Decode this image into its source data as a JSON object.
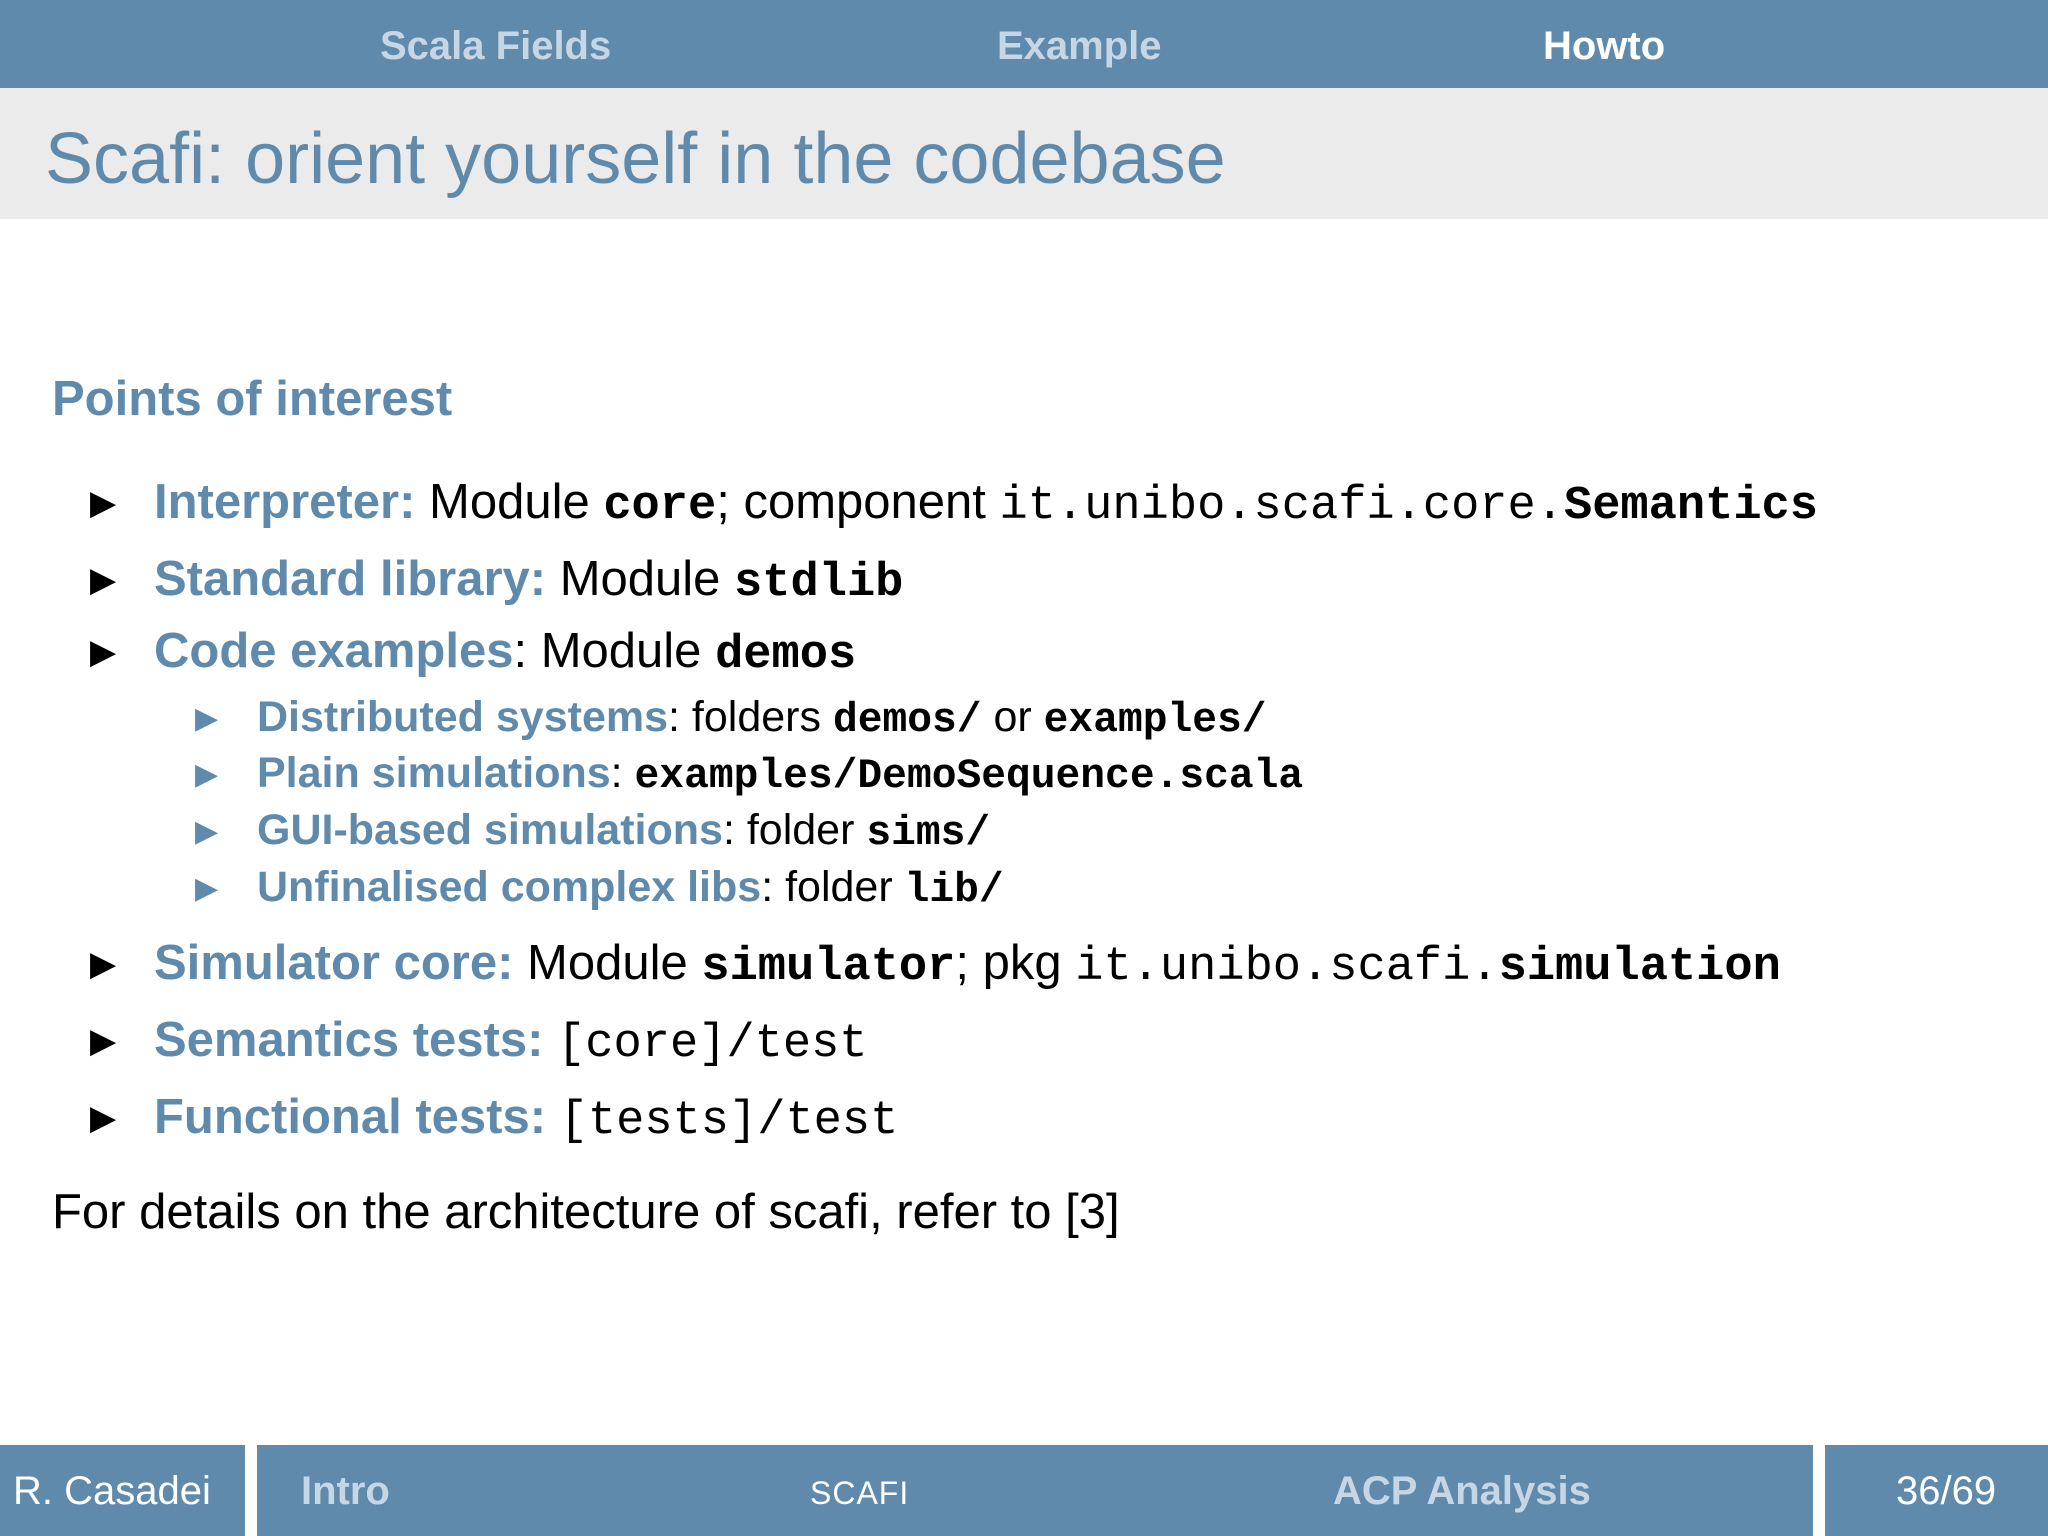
{
  "nav": {
    "items": [
      "Scala Fields",
      "Example",
      "Howto"
    ],
    "active": "Howto"
  },
  "slide": {
    "title": "Scafi: orient yourself in the codebase",
    "block_title": "Points of interest",
    "items": [
      {
        "key": "Interpreter:",
        "t1": " Module ",
        "m1": "core",
        "t2": "; component ",
        "m2": "it.unibo.scafi.core.",
        "m3": "Semantics"
      },
      {
        "key": "Standard library:",
        "t1": " Module ",
        "m1": "stdlib"
      },
      {
        "key": "Code examples",
        "t1": ": Module ",
        "m1": "demos"
      },
      {
        "key": "Simulator core:",
        "t1": " Module ",
        "m1": "simulator",
        "t2": "; pkg ",
        "m2": "it.unibo.scafi.",
        "m3": "simulation"
      },
      {
        "key": "Semantics tests:",
        "m2": "[core]/test"
      },
      {
        "key": "Functional tests:",
        "m2": "[tests]/test"
      }
    ],
    "subitems": [
      {
        "key": "Distributed systems",
        "t1": ": folders ",
        "m1": "demos/",
        "t2": " or ",
        "m2": "examples/"
      },
      {
        "key": "Plain simulations",
        "t1": ": ",
        "m1": "examples/DemoSequence.scala"
      },
      {
        "key": "GUI-based simulations",
        "t1": ": folder ",
        "m1": "sims/"
      },
      {
        "key": "Unfinalised complex libs",
        "t1": ": folder ",
        "m1": "lib/"
      }
    ],
    "note": "For details on the architecture of scafi, refer to [3]"
  },
  "footer": {
    "author": "R. Casadei",
    "section_left": "Intro",
    "center": "SCAFI",
    "section_right": "ACP Analysis",
    "page": "36/69"
  },
  "colors": {
    "accent": "#5f8aab",
    "title_bg": "#ebebeb",
    "inactive_nav": "#c7d6e4"
  },
  "icons": {
    "bullet": "triangle-right-icon"
  }
}
